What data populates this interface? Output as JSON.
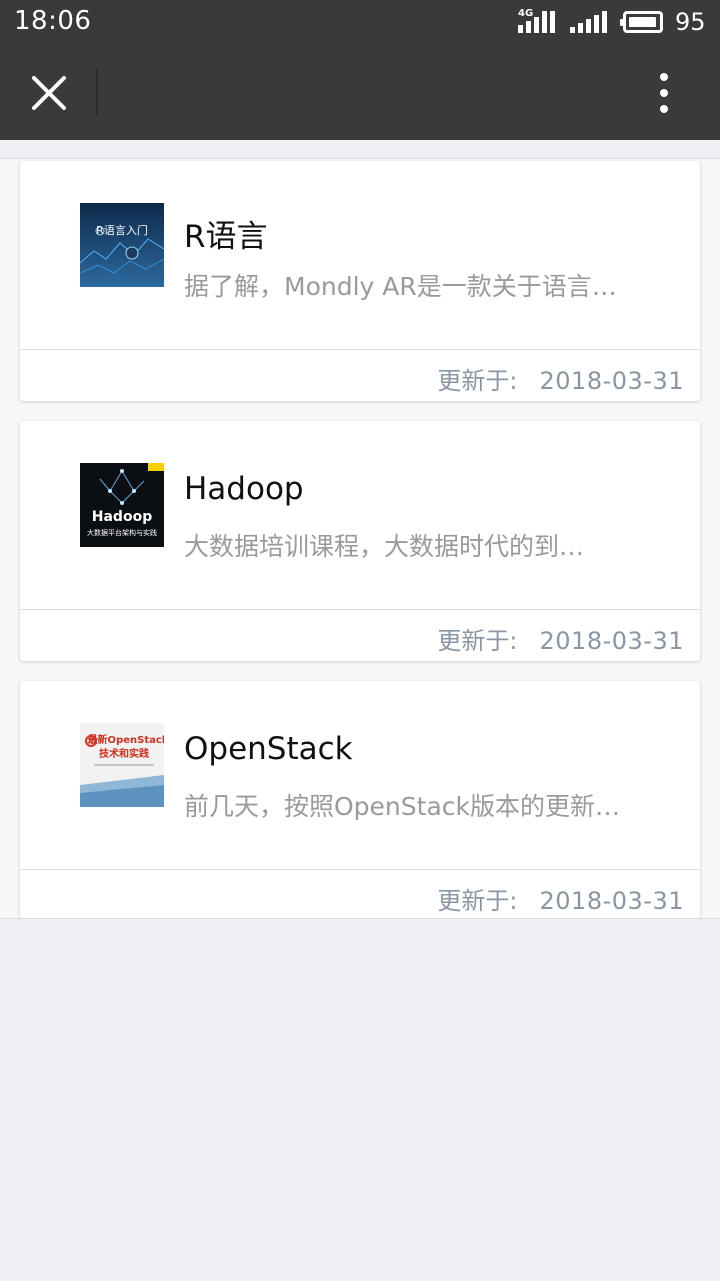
{
  "status_bar": {
    "time": "18:06",
    "network_label": "4G",
    "battery_level": "95",
    "battery_fraction": 0.95
  },
  "toolbar": {
    "close_icon": "close-icon",
    "more_icon": "more-vertical-icon"
  },
  "articles": [
    {
      "title": "R语言",
      "desc": "据了解，Mondly AR是一款关于语言…",
      "updated_label": "更新于:",
      "date": "2018-03-31",
      "thumb_text": "R语言入门"
    },
    {
      "title": "Hadoop",
      "desc": "大数据培训课程，大数据时代的到…",
      "updated_label": "更新于:",
      "date": "2018-03-31",
      "thumb_text": "Hadoop",
      "thumb_sub": "大数据平台架构与实践"
    },
    {
      "title": "OpenStack",
      "desc": "前几天，按照OpenStack版本的更新…",
      "updated_label": "更新于:",
      "date": "2018-03-31",
      "thumb_text": "最新OpenStack",
      "thumb_sub": "技术和实践"
    }
  ]
}
